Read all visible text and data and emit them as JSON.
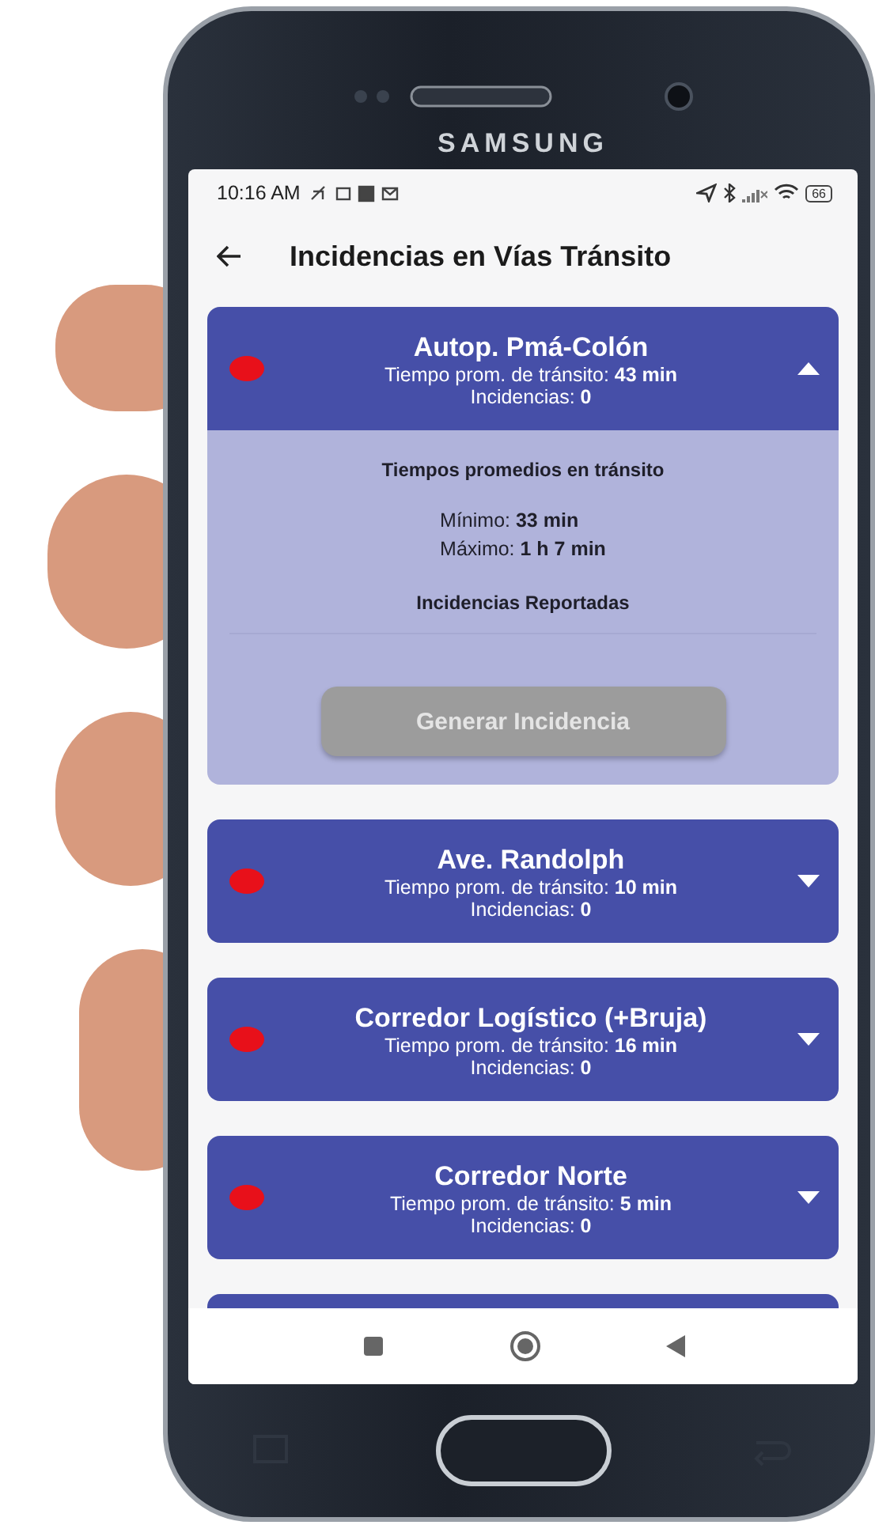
{
  "brand": "SAMSUNG",
  "status_bar": {
    "time": "10:16 AM",
    "battery": "66"
  },
  "app_bar": {
    "title": "Incidencias en Vías Tránsito"
  },
  "routes": [
    {
      "name": "Autop. Pmá-Colón",
      "time": "Tiempo prom. de tránsito: **43 min**",
      "incidents": "Incidencias: **0**",
      "color": "#e8101a",
      "expanded": true,
      "details": {
        "heading": "Tiempos promedios en tránsito",
        "minimum": "Mínimo: **33 min**",
        "maximum": "Máximo: **1 h 7 min**",
        "reported_heading": "Incidencias Reportadas",
        "button": {
          "label": "Generar Incidencia",
          "disabled": true
        }
      }
    },
    {
      "name": "Ave. Randolph",
      "time": "Tiempo prom. de tránsito: **10 min**",
      "incidents": "Incidencias: **0**",
      "color": "#e8101a",
      "expanded": false
    },
    {
      "name": "Corredor Logístico (+Bruja)",
      "time": "Tiempo prom. de tránsito: **16 min**",
      "incidents": "Incidencias: **0**",
      "color": "#e8101a",
      "expanded": false
    },
    {
      "name": "Corredor Norte",
      "time": "Tiempo prom. de tránsito: **5 min**",
      "incidents": "Incidencias: **0**",
      "color": "#e8101a",
      "expanded": false
    }
  ],
  "more_cards_below": true
}
